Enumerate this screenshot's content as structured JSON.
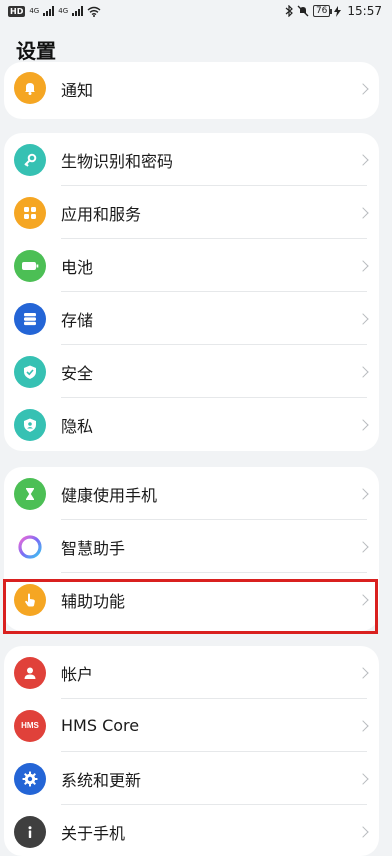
{
  "status_bar": {
    "left_badge": "HD",
    "network1": "4G",
    "network2": "4G",
    "battery": "76",
    "time": "15:57"
  },
  "page": {
    "title": "设置"
  },
  "groups": [
    {
      "items": [
        {
          "label": "通知",
          "icon": "bell-icon",
          "color": "#f5a623"
        }
      ]
    },
    {
      "items": [
        {
          "label": "生物识别和密码",
          "icon": "key-icon",
          "color": "#36c1b3"
        },
        {
          "label": "应用和服务",
          "icon": "apps-grid-icon",
          "color": "#f5a623"
        },
        {
          "label": "电池",
          "icon": "battery-icon",
          "color": "#4cbf55"
        },
        {
          "label": "存储",
          "icon": "storage-icon",
          "color": "#2465d6"
        },
        {
          "label": "安全",
          "icon": "shield-check-icon",
          "color": "#36c1b3"
        },
        {
          "label": "隐私",
          "icon": "privacy-shield-icon",
          "color": "#36c1b3"
        }
      ]
    },
    {
      "items": [
        {
          "label": "健康使用手机",
          "icon": "hourglass-icon",
          "color": "#4cbf55"
        },
        {
          "label": "智慧助手",
          "icon": "assistant-ring-icon",
          "color": "#a06cf0"
        },
        {
          "label": "辅助功能",
          "icon": "hand-pointer-icon",
          "color": "#f5a623"
        }
      ]
    },
    {
      "items": [
        {
          "label": "帐户",
          "icon": "user-icon",
          "color": "#e0413a"
        },
        {
          "label": "HMS Core",
          "icon": "hms-icon",
          "color": "#e0413a",
          "icon_text": "HMS"
        },
        {
          "label": "系统和更新",
          "icon": "gear-icon",
          "color": "#2465d6"
        },
        {
          "label": "关于手机",
          "icon": "info-icon",
          "color": "#3f3f3f"
        }
      ]
    }
  ]
}
